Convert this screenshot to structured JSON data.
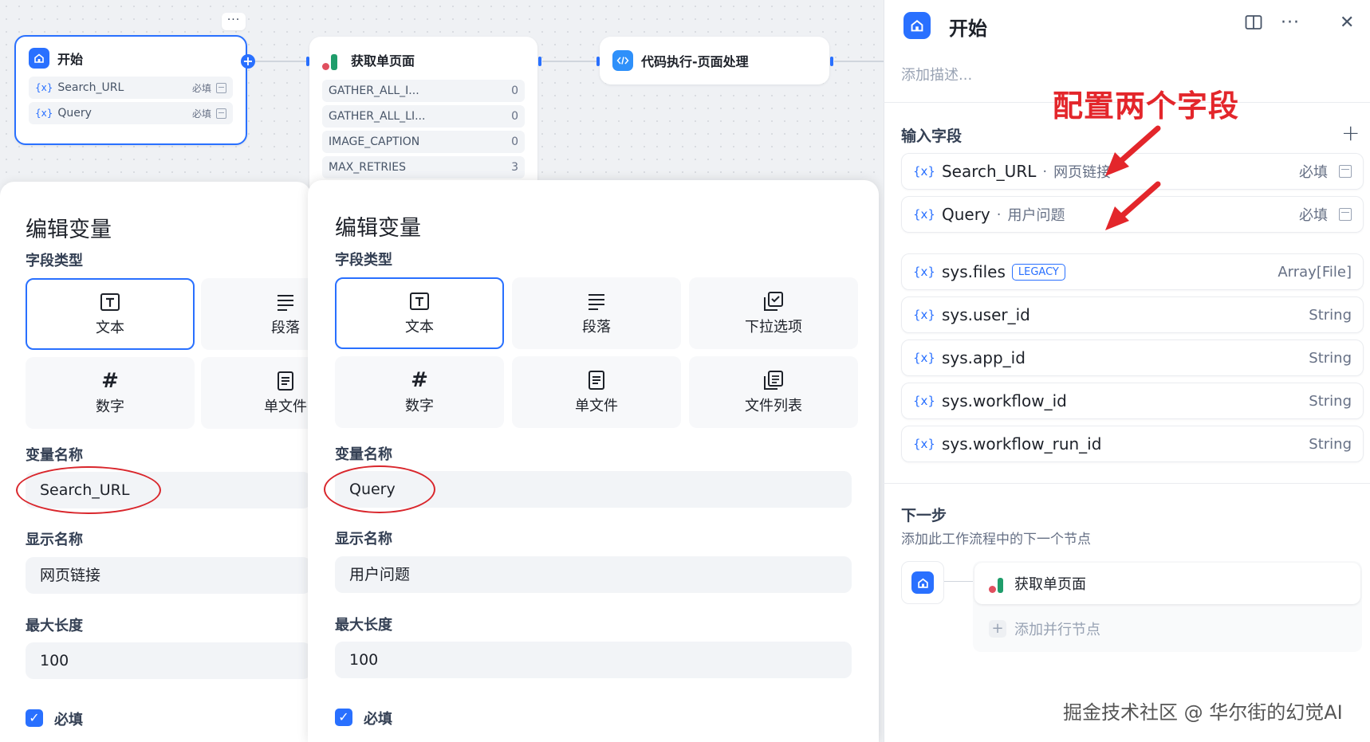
{
  "canvas": {
    "node_menu_label": "···",
    "start_node": {
      "title": "开始",
      "rows": [
        {
          "name": "Search_URL",
          "tag": "必填"
        },
        {
          "name": "Query",
          "tag": "必填"
        }
      ]
    },
    "fetch_node": {
      "title": "获取单页面",
      "rows": [
        {
          "name": "GATHER_ALL_I...",
          "value": "0"
        },
        {
          "name": "GATHER_ALL_LI...",
          "value": "0"
        },
        {
          "name": "IMAGE_CAPTION",
          "value": "0"
        },
        {
          "name": "MAX_RETRIES",
          "value": "3"
        }
      ]
    },
    "code_node": {
      "title": "代码执行-页面处理",
      "icon": "code-icon"
    }
  },
  "edit_left": {
    "title": "编辑变量",
    "field_type_label": "字段类型",
    "types": [
      "文本",
      "段落",
      "数字",
      "单文件"
    ],
    "var_name_label": "变量名称",
    "var_name": "Search_URL",
    "display_name_label": "显示名称",
    "display_name": "网页链接",
    "max_length_label": "最大长度",
    "max_length": "100",
    "required_label": "必填"
  },
  "edit_right": {
    "title": "编辑变量",
    "field_type_label": "字段类型",
    "types": [
      "文本",
      "段落",
      "下拉选项",
      "数字",
      "单文件",
      "文件列表"
    ],
    "var_name_label": "变量名称",
    "var_name": "Query",
    "display_name_label": "显示名称",
    "display_name": "用户问题",
    "max_length_label": "最大长度",
    "max_length": "100",
    "required_label": "必填"
  },
  "panel": {
    "title": "开始",
    "description_placeholder": "添加描述...",
    "annotation": "配置两个字段",
    "input_fields_label": "输入字段",
    "add_label": "+",
    "input_fields": [
      {
        "name": "Search_URL",
        "display": "网页链接",
        "tag": "必填"
      },
      {
        "name": "Query",
        "display": "用户问题",
        "tag": "必填"
      }
    ],
    "sys_vars": [
      {
        "name": "sys.files",
        "badge": "LEGACY",
        "type": "Array[File]"
      },
      {
        "name": "sys.user_id",
        "type": "String"
      },
      {
        "name": "sys.app_id",
        "type": "String"
      },
      {
        "name": "sys.workflow_id",
        "type": "String"
      },
      {
        "name": "sys.workflow_run_id",
        "type": "String"
      }
    ],
    "next_step_label": "下一步",
    "next_step_desc": "添加此工作流程中的下一个节点",
    "next_node": "获取单页面",
    "add_parallel": "添加并行节点",
    "var_prefix": "{x}",
    "dot_sep": "·"
  },
  "watermark": "掘金技术社区 @ 华尔街的幻觉AI",
  "colors": {
    "accent": "#2970ff",
    "annotation_red": "#e3262b"
  }
}
